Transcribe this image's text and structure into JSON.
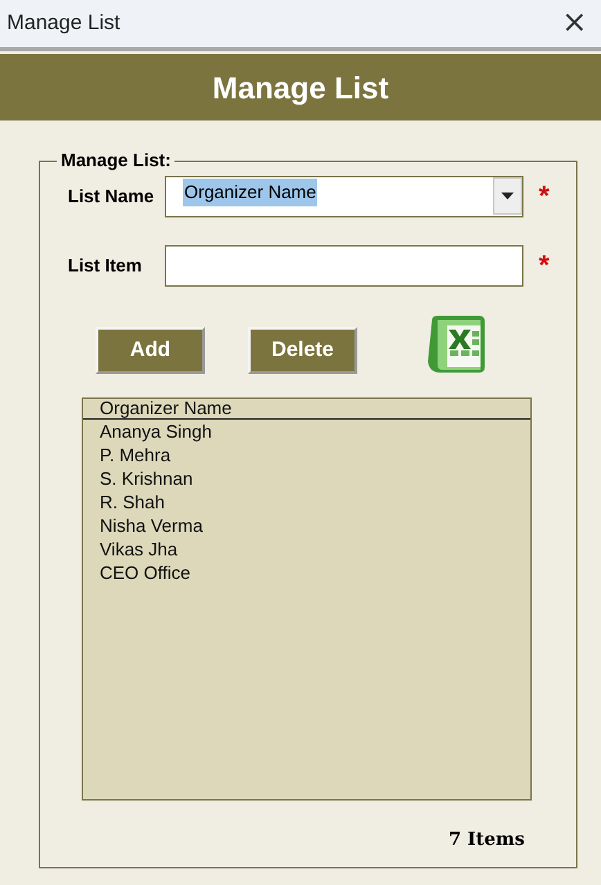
{
  "window": {
    "title": "Manage List",
    "close": "×"
  },
  "header": {
    "title": "Manage List"
  },
  "group": {
    "legend": "Manage List:",
    "list_name": {
      "label": "List Name",
      "value": "Organizer Name",
      "highlighted": true,
      "required": "*"
    },
    "list_item": {
      "label": "List Item",
      "required": "*"
    },
    "buttons": [
      "Add",
      "Delete"
    ],
    "list": {
      "header": "Organizer Name",
      "items": [
        "Ananya Singh",
        "P. Mehra",
        "S. Krishnan",
        "R. Shah",
        "Nisha Verma",
        "Vikas Jha",
        "CEO Office"
      ]
    },
    "count": "7 Items"
  }
}
